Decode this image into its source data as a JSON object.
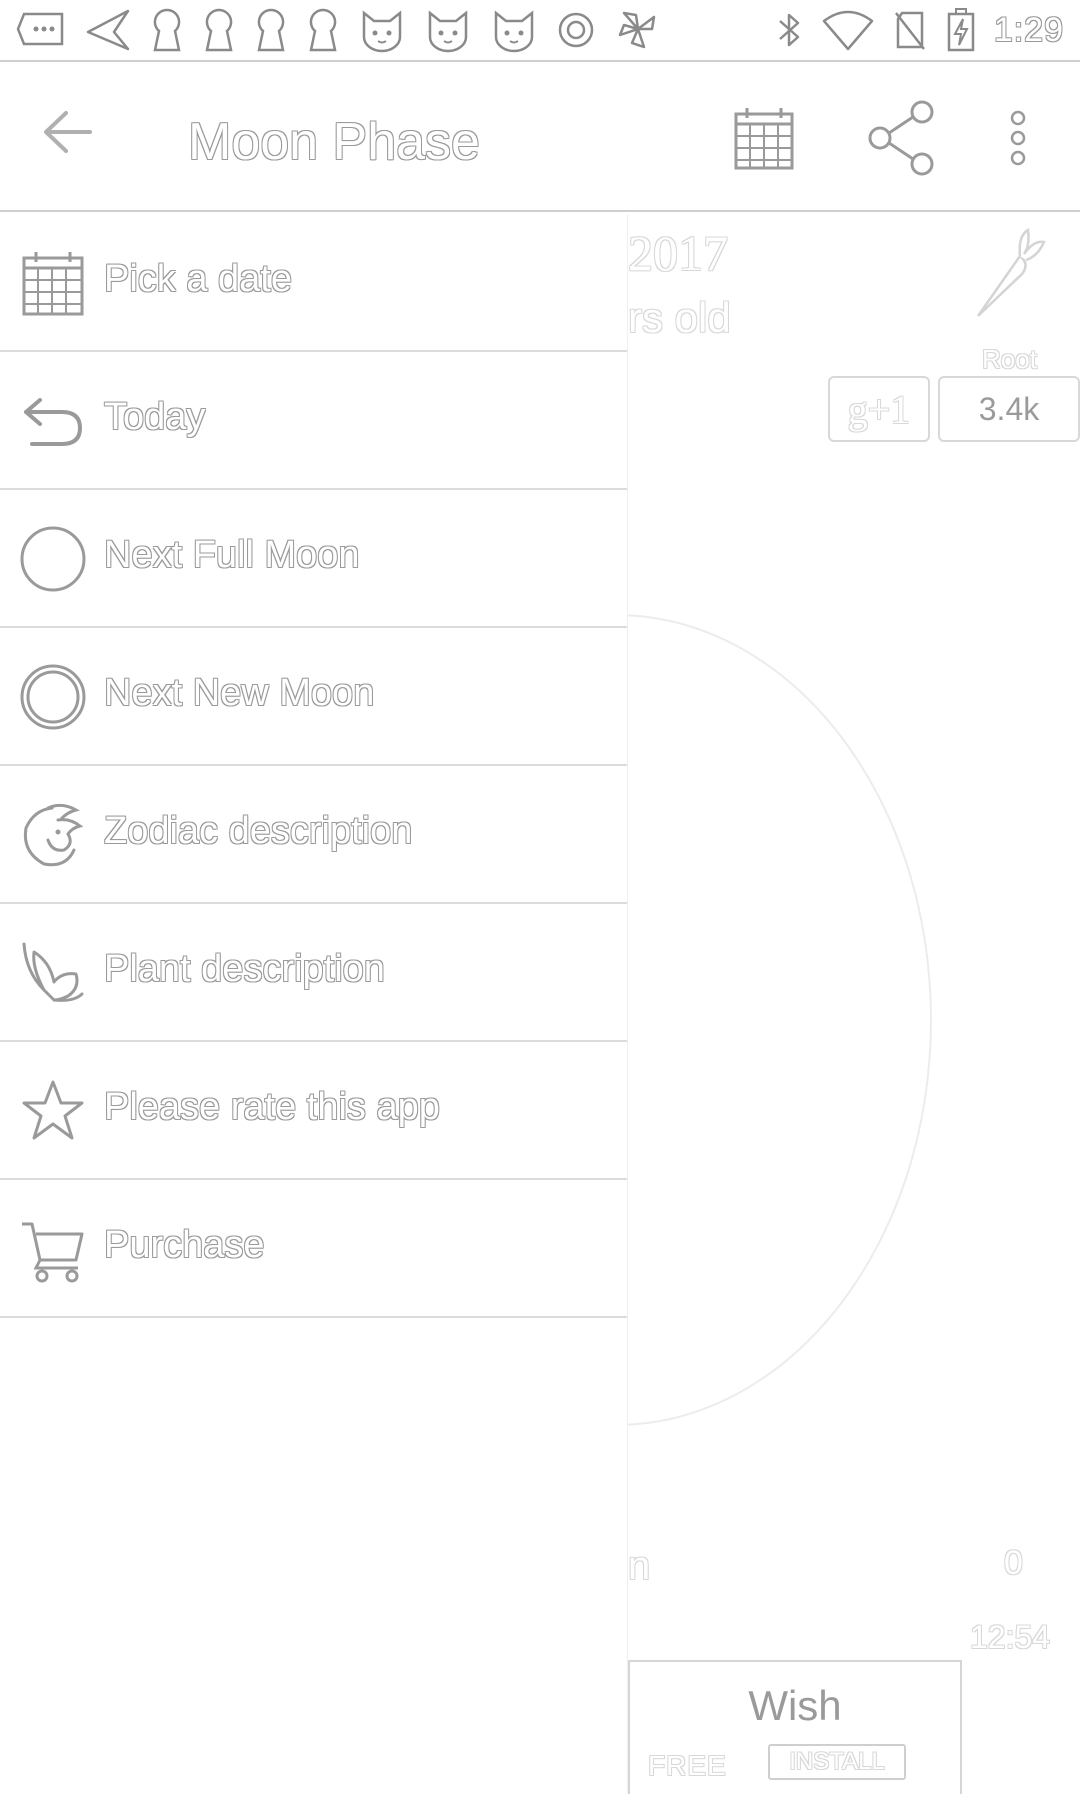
{
  "status_bar": {
    "time": "1:29",
    "left_icons": [
      "message-bubble-icon",
      "send-icon",
      "keyhole-icon",
      "keyhole-icon",
      "keyhole-icon",
      "keyhole-icon",
      "cat-face-icon",
      "cat-face-icon",
      "cat-face-icon",
      "circle-target-icon",
      "fan-icon"
    ],
    "right_icons": [
      "bluetooth-icon",
      "wifi-icon",
      "no-sim-icon",
      "battery-charging-icon"
    ]
  },
  "app_bar": {
    "title": "Moon Phase",
    "actions": [
      "calendar-icon",
      "share-icon",
      "more-vert-icon"
    ]
  },
  "drawer": {
    "items": [
      {
        "label": "Pick a date",
        "icon": "calendar-icon"
      },
      {
        "label": "Today",
        "icon": "undo-arrow-icon"
      },
      {
        "label": "Next Full Moon",
        "icon": "full-moon-icon"
      },
      {
        "label": "Next New Moon",
        "icon": "new-moon-icon"
      },
      {
        "label": "Zodiac description",
        "icon": "zodiac-bull-icon"
      },
      {
        "label": "Plant description",
        "icon": "plant-leaf-icon"
      },
      {
        "label": "Please rate this app",
        "icon": "star-icon"
      },
      {
        "label": "Purchase",
        "icon": "shopping-cart-icon"
      }
    ]
  },
  "background": {
    "year": "2017",
    "age_fragment": "rs old",
    "plant_label": "Root",
    "gplus_label": "g+1",
    "gplus_count": "3.4k",
    "bottom_fragment": "n",
    "bottom_value": "0",
    "clock": "12:54"
  },
  "ad": {
    "title": "Wish",
    "free_label": "FREE",
    "install_label": "INSTALL"
  }
}
